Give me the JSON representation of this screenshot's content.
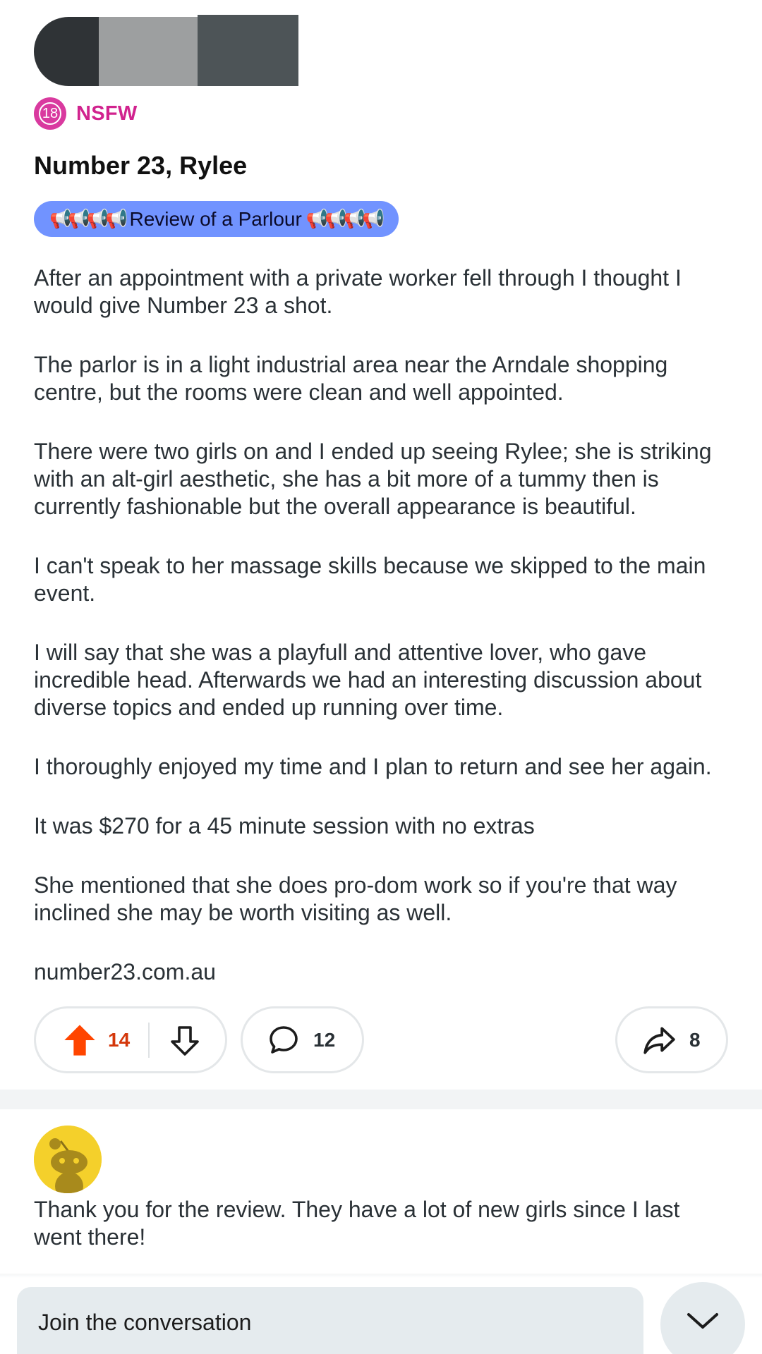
{
  "post": {
    "nsfw_badge": "18",
    "nsfw_label": "NSFW",
    "title": "Number 23, Rylee",
    "flair": {
      "prefix": "📢📢📢📢",
      "text": "Review of a Parlour",
      "suffix": "📢📢📢📢",
      "color": "#7193ff"
    },
    "paragraphs": [
      "After an appointment with a private worker fell through I thought I would give Number 23 a shot.",
      "The parlor is in a light industrial area near the Arndale shopping centre, but the rooms were clean and well appointed.",
      "There were two girls on and I ended up seeing Rylee; she is striking with an alt-girl aesthetic, she has a bit more of a tummy then is currently fashionable but the overall appearance is beautiful.",
      "I can't speak to her massage skills because we skipped to the main event.",
      "I will say that she was a playfull and attentive lover, who gave incredible head. Afterwards we had an interesting discussion about diverse topics and ended up running over time.",
      "I thoroughly enjoyed my time and I plan to return and see her again.",
      "It was $270 for a 45 minute session with no extras",
      "She mentioned that she does pro-dom work so if you're that way inclined she may be worth visiting as well.",
      "number23.com.au"
    ],
    "votes": "14",
    "comments": "12",
    "shares": "8"
  },
  "comment": {
    "text": "Thank you for the review. They have a lot of new girls since I last went there!"
  },
  "composer": {
    "placeholder": "Join the conversation"
  },
  "icons": {
    "nsfw": "nsfw-18-icon",
    "upvote": "upvote-arrow-icon",
    "downvote": "downvote-arrow-icon",
    "comment": "comment-bubble-icon",
    "share": "share-arrow-icon",
    "avatar": "snoo-avatar-icon",
    "collapse": "chevron-down-icon"
  },
  "colors": {
    "nsfw": "#d93a9f",
    "upvote_active": "#ff4500",
    "background": "#ffffff",
    "input_bg": "#e5ebee"
  }
}
